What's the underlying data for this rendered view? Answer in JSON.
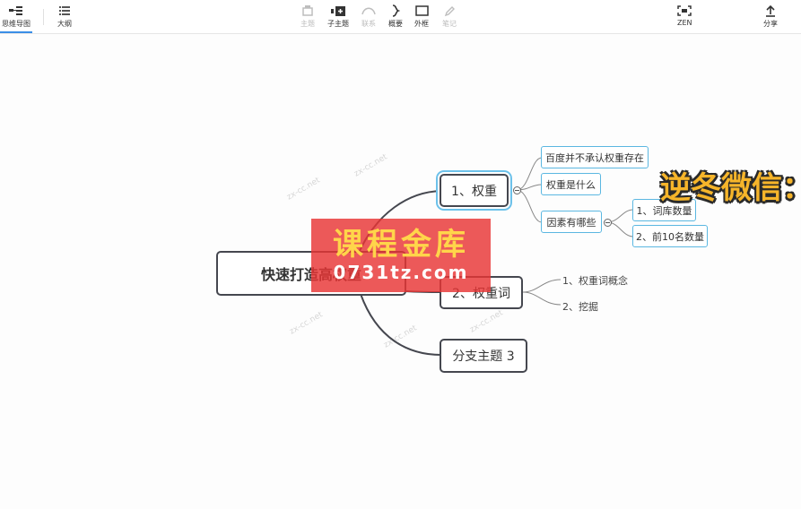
{
  "toolbar": {
    "left_tabs": [
      {
        "label": "思维导图",
        "icon": "mindmap-icon",
        "active": true
      },
      {
        "label": "大纲",
        "icon": "outline-icon",
        "active": false
      }
    ],
    "center_tools": [
      {
        "label": "主题",
        "icon": "topic-icon",
        "enabled": false
      },
      {
        "label": "子主题",
        "icon": "subtopic-icon",
        "enabled": true
      },
      {
        "label": "联系",
        "icon": "relationship-icon",
        "enabled": false
      },
      {
        "label": "概要",
        "icon": "summary-brace-icon",
        "enabled": true
      },
      {
        "label": "外框",
        "icon": "boundary-box-icon",
        "enabled": true
      },
      {
        "label": "笔记",
        "icon": "note-pen-icon",
        "enabled": false
      }
    ],
    "zen": {
      "label": "ZEN",
      "icon": "zen-mode-icon"
    },
    "share": {
      "label": "分享",
      "icon": "share-upload-icon"
    }
  },
  "mindmap": {
    "root": {
      "label": "快速打造高权重"
    },
    "branches": [
      {
        "label": "1、权重",
        "selected": true,
        "children": [
          {
            "label": "百度并不承认权重存在"
          },
          {
            "label": "权重是什么"
          },
          {
            "label": "因素有哪些",
            "children": [
              {
                "label": "1、词库数量"
              },
              {
                "label": "2、前10名数量"
              }
            ]
          }
        ]
      },
      {
        "label": "2、权重词",
        "children": [
          {
            "label": "1、权重词概念"
          },
          {
            "label": "2、挖掘"
          }
        ]
      },
      {
        "label": "分支主题 3",
        "children": []
      }
    ]
  },
  "watermark": {
    "text": "zx-cc.net"
  },
  "overlay": {
    "banner_line1": "课程金库",
    "banner_line2": "0731tz.com",
    "yellow_text": "逆冬微信："
  },
  "colors": {
    "main_border": "#45474f",
    "sub_border": "#5bb7e1",
    "connector": "#45474f",
    "banner_bg": "#e83434",
    "banner_text": "#ffd54a",
    "yellow_text": "#f6b52a"
  }
}
